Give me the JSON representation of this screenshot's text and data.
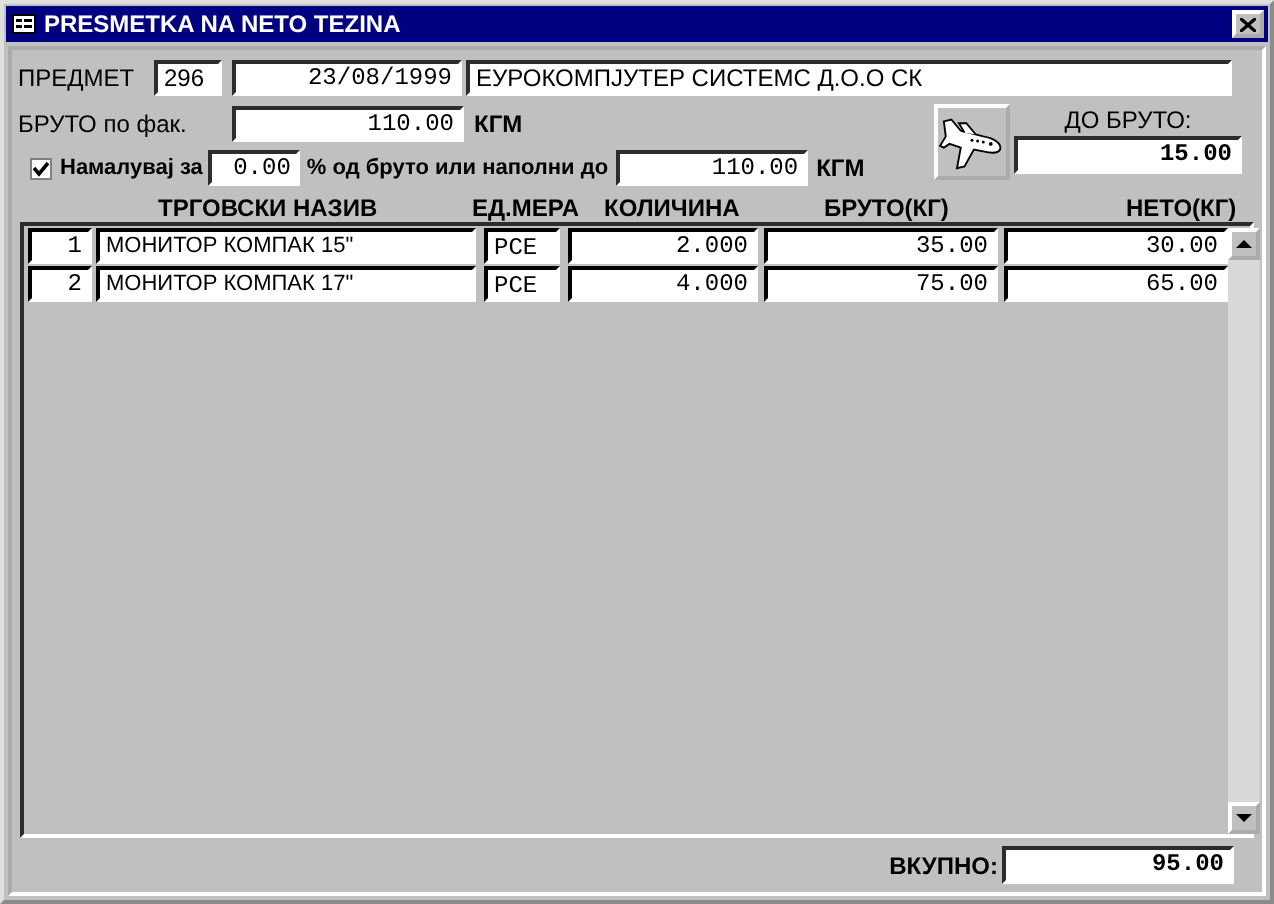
{
  "window": {
    "title": "PRESMETKA NA NETO TEZINA"
  },
  "header": {
    "label": "ПРЕДМЕТ",
    "number": "296",
    "date": "23/08/1999",
    "company": "ЕУРОКОМПЈУТЕР СИСТЕМС  Д.О.О СК"
  },
  "gross": {
    "label": "БРУТО по фак.",
    "value": "110.00",
    "unit": "КГМ"
  },
  "reduce": {
    "checked": true,
    "label": "Намалувај за",
    "percent": "0.00",
    "middle_text": "% од бруто или наполни до",
    "target": "110.00",
    "unit": "КГМ"
  },
  "to_gross": {
    "label": "ДО БРУТО:",
    "value": "15.00"
  },
  "table": {
    "columns": [
      "ТРГОВСКИ НАЗИВ",
      "ЕД.МЕРА",
      "КОЛИЧИНА",
      "БРУТО(КГ)",
      "НЕТО(КГ)"
    ],
    "rows": [
      {
        "number": "1",
        "cells": [
          "МОНИТОР КОМПАК 15\"",
          "PCE",
          "2.000",
          "35.00",
          "30.00"
        ]
      },
      {
        "number": "2",
        "cells": [
          "МОНИТОР КОМПАК 17\"",
          "PCE",
          "4.000",
          "75.00",
          "65.00"
        ]
      }
    ]
  },
  "total": {
    "label": "ВКУПНО:",
    "value": "95.00"
  }
}
